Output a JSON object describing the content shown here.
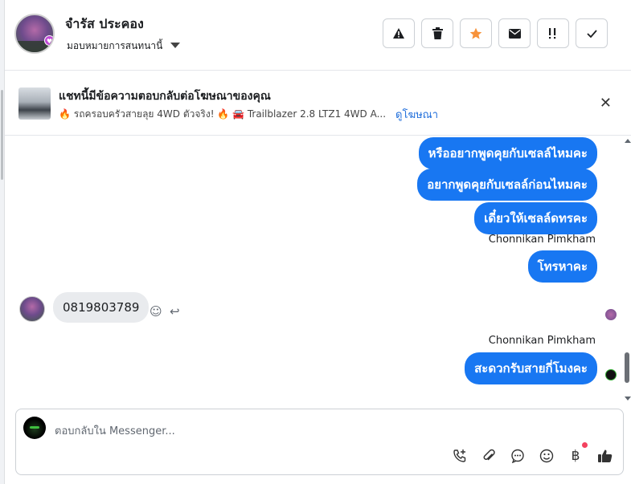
{
  "header": {
    "contact_name": "จำรัส ประคอง",
    "assign_label": "มอบหมายการสนทนานี้",
    "actions": [
      {
        "icon": "warning-icon"
      },
      {
        "icon": "trash-icon"
      },
      {
        "icon": "star-icon",
        "color": "#f7923a"
      },
      {
        "icon": "mail-icon"
      },
      {
        "icon": "follow-up-icon"
      },
      {
        "icon": "check-icon"
      }
    ]
  },
  "banner": {
    "title": "แชทนี้มีข้อความตอบกลับต่อโฆษณาของคุณ",
    "ad_text": "🔥 รถครอบครัวสายลุย 4WD ตัวจริง! 🔥 🚘 Trailblazer 2.8 LTZ1 4WD A...",
    "link_label": "ดูโฆษณา"
  },
  "messages": {
    "out1": "หรืออยากพูดคุยกับเซลล์ไหมคะ",
    "out2": "อยากพูดคุยกับเซลล์ก่อนไหมคะ",
    "out3": "เดี๋ยวให้เซลล์ดทรคะ",
    "sender1": "Chonnikan Pimkham",
    "out4": "โทรหาคะ",
    "in1": "0819803789",
    "sender2": "Chonnikan Pimkham",
    "out5": "สะดวกรับสายกี่โมงคะ"
  },
  "composer": {
    "placeholder": "ตอบกลับใน Messenger...",
    "tools": [
      "call-icon",
      "attach-icon",
      "chat-bubble-icon",
      "emoji-icon",
      "baht-icon",
      "thumbs-up-icon"
    ]
  },
  "colors": {
    "brand_blue": "#1877f2",
    "incoming_bubble": "#e9ebee"
  }
}
